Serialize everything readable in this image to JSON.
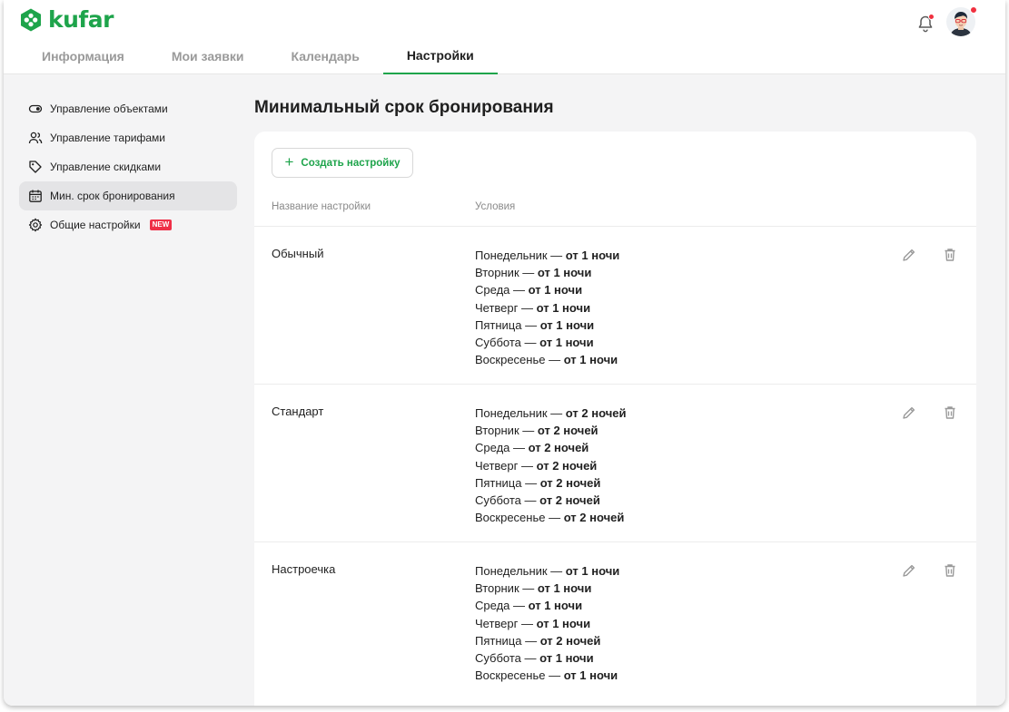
{
  "brand": {
    "name": "kufar",
    "accent": "#1ea44b",
    "alert": "#f0303f"
  },
  "tabs": [
    {
      "label": "Информация",
      "active": false
    },
    {
      "label": "Мои заявки",
      "active": false
    },
    {
      "label": "Календарь",
      "active": false
    },
    {
      "label": "Настройки",
      "active": true
    }
  ],
  "header": {
    "bell_icon": "bell-icon",
    "avatar": "user-avatar"
  },
  "sidebar": {
    "items": [
      {
        "label": "Управление объектами",
        "icon": "toggle-icon",
        "active": false
      },
      {
        "label": "Управление тарифами",
        "icon": "users-icon",
        "active": false
      },
      {
        "label": "Управление скидками",
        "icon": "tag-icon",
        "active": false
      },
      {
        "label": "Мин. срок бронирования",
        "icon": "calendar-icon",
        "active": true
      },
      {
        "label": "Общие настройки",
        "icon": "gear-icon",
        "active": false,
        "badge": "NEW"
      }
    ]
  },
  "main": {
    "title": "Минимальный срок бронирования",
    "create_button": "Создать настройку",
    "columns": {
      "name": "Название настройки",
      "conditions": "Условия"
    },
    "settings": [
      {
        "name": "Обычный",
        "conditions": [
          {
            "day": "Понедельник — ",
            "value": "от 1 ночи"
          },
          {
            "day": "Вторник — ",
            "value": "от 1 ночи"
          },
          {
            "day": "Среда — ",
            "value": "от 1 ночи"
          },
          {
            "day": "Четверг — ",
            "value": "от 1 ночи"
          },
          {
            "day": "Пятница — ",
            "value": "от 1 ночи"
          },
          {
            "day": "Суббота — ",
            "value": "от 1 ночи"
          },
          {
            "day": "Воскресенье — ",
            "value": "от 1 ночи"
          }
        ]
      },
      {
        "name": "Стандарт",
        "conditions": [
          {
            "day": "Понедельник — ",
            "value": "от 2 ночей"
          },
          {
            "day": "Вторник — ",
            "value": "от 2 ночей"
          },
          {
            "day": "Среда — ",
            "value": "от 2 ночей"
          },
          {
            "day": "Четверг — ",
            "value": "от 2 ночей"
          },
          {
            "day": "Пятница — ",
            "value": "от 2 ночей"
          },
          {
            "day": "Суббота — ",
            "value": "от 2 ночей"
          },
          {
            "day": "Воскресенье — ",
            "value": "от 2 ночей"
          }
        ]
      },
      {
        "name": "Настроечка",
        "conditions": [
          {
            "day": "Понедельник — ",
            "value": "от 1 ночи"
          },
          {
            "day": "Вторник — ",
            "value": "от 1 ночи"
          },
          {
            "day": "Среда — ",
            "value": "от 1 ночи"
          },
          {
            "day": "Четверг — ",
            "value": "от 1 ночи"
          },
          {
            "day": "Пятница — ",
            "value": "от 2 ночей"
          },
          {
            "day": "Суббота — ",
            "value": "от 1 ночи"
          },
          {
            "day": "Воскресенье — ",
            "value": "от 1 ночи"
          }
        ]
      }
    ]
  }
}
